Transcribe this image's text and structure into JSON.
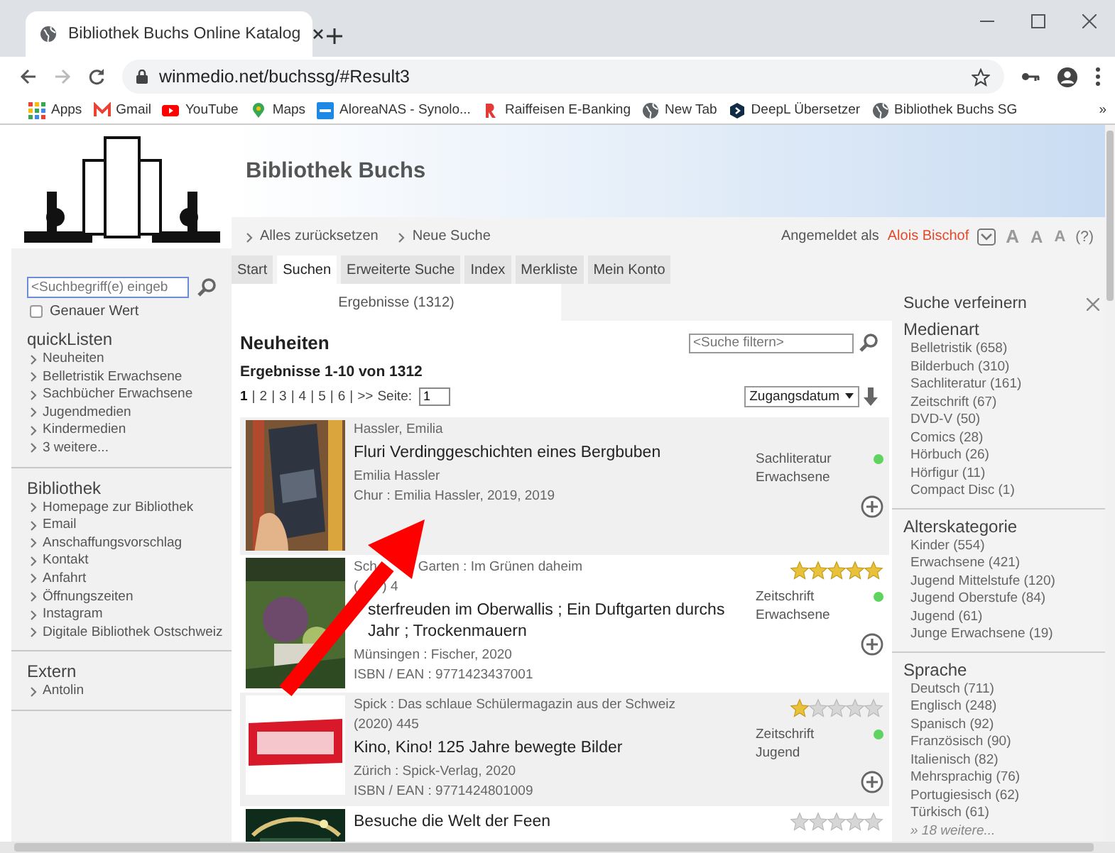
{
  "browser": {
    "tab_title": "Bibliothek Buchs Online Katalog",
    "url": "winmedio.net/buchssg/#Result3",
    "bookmarks": [
      "Apps",
      "Gmail",
      "YouTube",
      "Maps",
      "AloreaNAS - Synolo...",
      "Raiffeisen E-Banking",
      "New Tab",
      "DeepL Übersetzer",
      "Bibliothek Buchs SG"
    ],
    "more": "»"
  },
  "header": {
    "title": "Bibliothek Buchs"
  },
  "breadcrumb": [
    "Alles zurücksetzen",
    "Neue Suche"
  ],
  "user": {
    "prefix": "Angemeldet als",
    "name": "Alois Bischof",
    "font_sizes": [
      "A",
      "A",
      "A"
    ],
    "help": "(?)"
  },
  "tabs": [
    {
      "label": "Start",
      "selected": false
    },
    {
      "label": "Suchen",
      "selected": true
    },
    {
      "label": "Erweiterte Suche",
      "selected": false
    },
    {
      "label": "Index",
      "selected": false
    },
    {
      "label": "Merkliste",
      "selected": false
    },
    {
      "label": "Mein Konto",
      "selected": false
    }
  ],
  "subtabs": [
    {
      "label": "Ergebnisse (1312)",
      "selected": true
    }
  ],
  "sidebar": {
    "search": {
      "placeholder": "<Suchbegriff(e) eingeb"
    },
    "exact": {
      "label": "Genauer Wert",
      "checked": false
    },
    "sections": [
      {
        "title": "quickListen",
        "items": [
          "Neuheiten",
          "Belletristik Erwachsene",
          "Sachbücher Erwachsene",
          "Jugendmedien",
          "Kindermedien",
          "3 weitere..."
        ]
      },
      {
        "title": "Bibliothek",
        "items": [
          "Homepage zur Bibliothek",
          "Email",
          "Anschaffungsvorschlag",
          "Kontakt",
          "Anfahrt",
          "Öffnungszeiten",
          "Instagram",
          "Digitale Bibliothek Ostschweiz"
        ]
      },
      {
        "title": "Extern",
        "items": [
          "Antolin"
        ]
      }
    ]
  },
  "results": {
    "heading": "Neuheiten",
    "filter": {
      "placeholder": "<Suche filtern>"
    },
    "summary": "Ergebnisse 1-10 von 1312",
    "pages": [
      {
        "label": "1",
        "selected": true
      },
      {
        "label": "2",
        "selected": false
      },
      {
        "label": "3",
        "selected": false
      },
      {
        "label": "4",
        "selected": false
      },
      {
        "label": "5",
        "selected": false
      },
      {
        "label": "6",
        "selected": false
      }
    ],
    "separator": "|",
    "next": ">>",
    "page_label": "Seite:",
    "page_value": "1",
    "sort": "Zugangsdatum",
    "items": [
      {
        "pre": [
          "Hassler, Emilia"
        ],
        "title": "Fluri Verdinggeschichten eines Bergbuben",
        "post": [
          "Emilia Hassler",
          "Chur : Emilia Hassler, 2019, 2019"
        ],
        "media": [
          "Sachliteratur",
          "Erwachsene"
        ],
        "available": true
      },
      {
        "pre": [
          [
            "Sch",
            "Garten : Im Grünen daheim"
          ],
          [
            "(",
            ") 4"
          ]
        ],
        "title": [
          "sterfreuden im Oberwallis ; Ein Duftgarten durchs Jahr ; Trockenmauern"
        ],
        "post": [
          "Münsingen : Fischer, 2020",
          "ISBN / EAN : 9771423437001"
        ],
        "media": [
          "Zeitschrift",
          "Erwachsene"
        ],
        "available": true,
        "stars": 5
      },
      {
        "pre": [
          "Spick : Das schlaue Schülermagazin aus der Schweiz",
          "(2020) 445"
        ],
        "title": "Kino, Kino! 125 Jahre bewegte Bilder",
        "post": [
          "Zürich : Spick-Verlag, 2020",
          "ISBN / EAN : 9771424801009"
        ],
        "media": [
          "Zeitschrift",
          "Jugend"
        ],
        "available": true,
        "stars": 1
      },
      {
        "title": "Besuche die Welt der Feen",
        "stars": 0
      }
    ]
  },
  "refine": {
    "title": "Suche verfeinern",
    "groups": [
      {
        "title": "Medienart",
        "items": [
          "Belletristik (658)",
          "Bilderbuch (310)",
          "Sachliteratur (161)",
          "Zeitschrift (67)",
          "DVD-V (50)",
          "Comics (28)",
          "Hörbuch (26)",
          "Hörfigur (11)",
          "Compact Disc (1)"
        ]
      },
      {
        "title": "Alterskategorie",
        "items": [
          "Kinder (554)",
          "Erwachsene (421)",
          "Jugend Mittelstufe (120)",
          "Jugend Oberstufe (84)",
          "Jugend (61)",
          "Junge Erwachsene (19)"
        ]
      },
      {
        "title": "Sprache",
        "items": [
          "Deutsch (711)",
          "Englisch (248)",
          "Spanisch (92)",
          "Französisch (90)",
          "Italienisch (82)",
          "Mehrsprachig (76)",
          "Portugiesisch (62)",
          "Türkisch (61)"
        ],
        "more": "» 18 weitere..."
      }
    ]
  }
}
